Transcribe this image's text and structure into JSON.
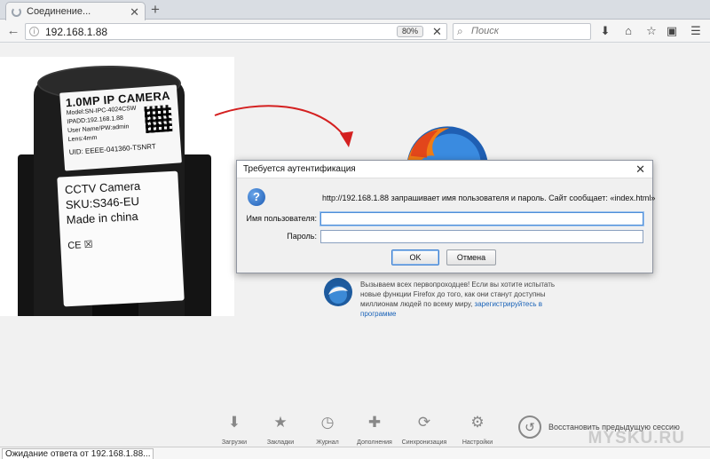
{
  "tab": {
    "title": "Соединение..."
  },
  "navbar": {
    "url": "192.168.1.88",
    "zoom": "80%",
    "search_placeholder": "Поиск"
  },
  "photo": {
    "label1_title": "1.0MP IP CAMERA",
    "label1_lines": [
      "Model:SN-IPC-4024CSW",
      "IPADD:192.168.1.88",
      "User Name/PW:admin",
      "Lens:4mm"
    ],
    "label1_uid": "UID: EEEE-041360-TSNRT",
    "label2_lines": [
      "CCTV Camera",
      "SKU:S346-EU",
      "Made in china"
    ],
    "label2_marks": "CE ☒"
  },
  "dialog": {
    "title": "Требуется аутентификация",
    "message": "http://192.168.1.88 запрашивает имя пользователя и пароль. Сайт сообщает: «index.html»",
    "username_label": "Имя пользователя:",
    "password_label": "Пароль:",
    "username_value": "",
    "password_value": "",
    "ok_label": "OK",
    "cancel_label": "Отмена"
  },
  "promo": {
    "text": "Вызываем всех первопроходцев! Если вы хотите испытать новые функции Firefox до того, как они станут доступны миллионам людей по всему миру,",
    "link": "зарегистрируйтесь в программе"
  },
  "bottom_tools": [
    {
      "label": "Загрузки",
      "icon": "download-icon"
    },
    {
      "label": "Закладки",
      "icon": "star-icon"
    },
    {
      "label": "Журнал",
      "icon": "clock-icon"
    },
    {
      "label": "Дополнения",
      "icon": "puzzle-icon"
    },
    {
      "label": "Синхронизация",
      "icon": "sync-icon"
    },
    {
      "label": "Настройки",
      "icon": "gear-icon"
    }
  ],
  "restore_label": "Восстановить предыдущую сессию",
  "status_text": "Ожидание ответа от 192.168.1.88...",
  "watermark": "MYSKU.RU",
  "colors": {
    "dialog_bg": "#f0f0f0",
    "link": "#1a63b8",
    "arrow": "#d42020"
  }
}
